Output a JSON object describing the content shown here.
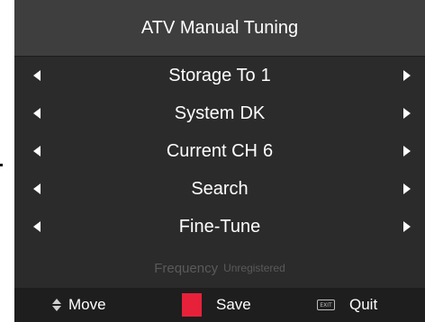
{
  "title": "ATV Manual Tuning",
  "rows": [
    {
      "label": "Storage To",
      "value": "1"
    },
    {
      "label": "System",
      "value": "DK"
    },
    {
      "label": "Current CH",
      "value": "6"
    },
    {
      "label": "Search",
      "value": ""
    },
    {
      "label": "Fine-Tune",
      "value": ""
    }
  ],
  "frequency": {
    "label": "Frequency",
    "value": "Unregistered"
  },
  "footer": {
    "move_label": "Move",
    "save_label": "Save",
    "quit_label": "Quit",
    "exit_key_text": "EXIT"
  },
  "icons": {
    "left": "arrow-left-icon",
    "right": "arrow-right-icon",
    "move": "up-down-icon",
    "save": "red-button-icon",
    "quit": "exit-key-icon"
  },
  "colors": {
    "panel_background": "#2b2b2b",
    "title_bar": "#3e3e3e",
    "footer_bar": "#1e1e1e",
    "text": "#ffffff",
    "dim_text": "#5a5a5a",
    "save_key": "#e8213a"
  }
}
